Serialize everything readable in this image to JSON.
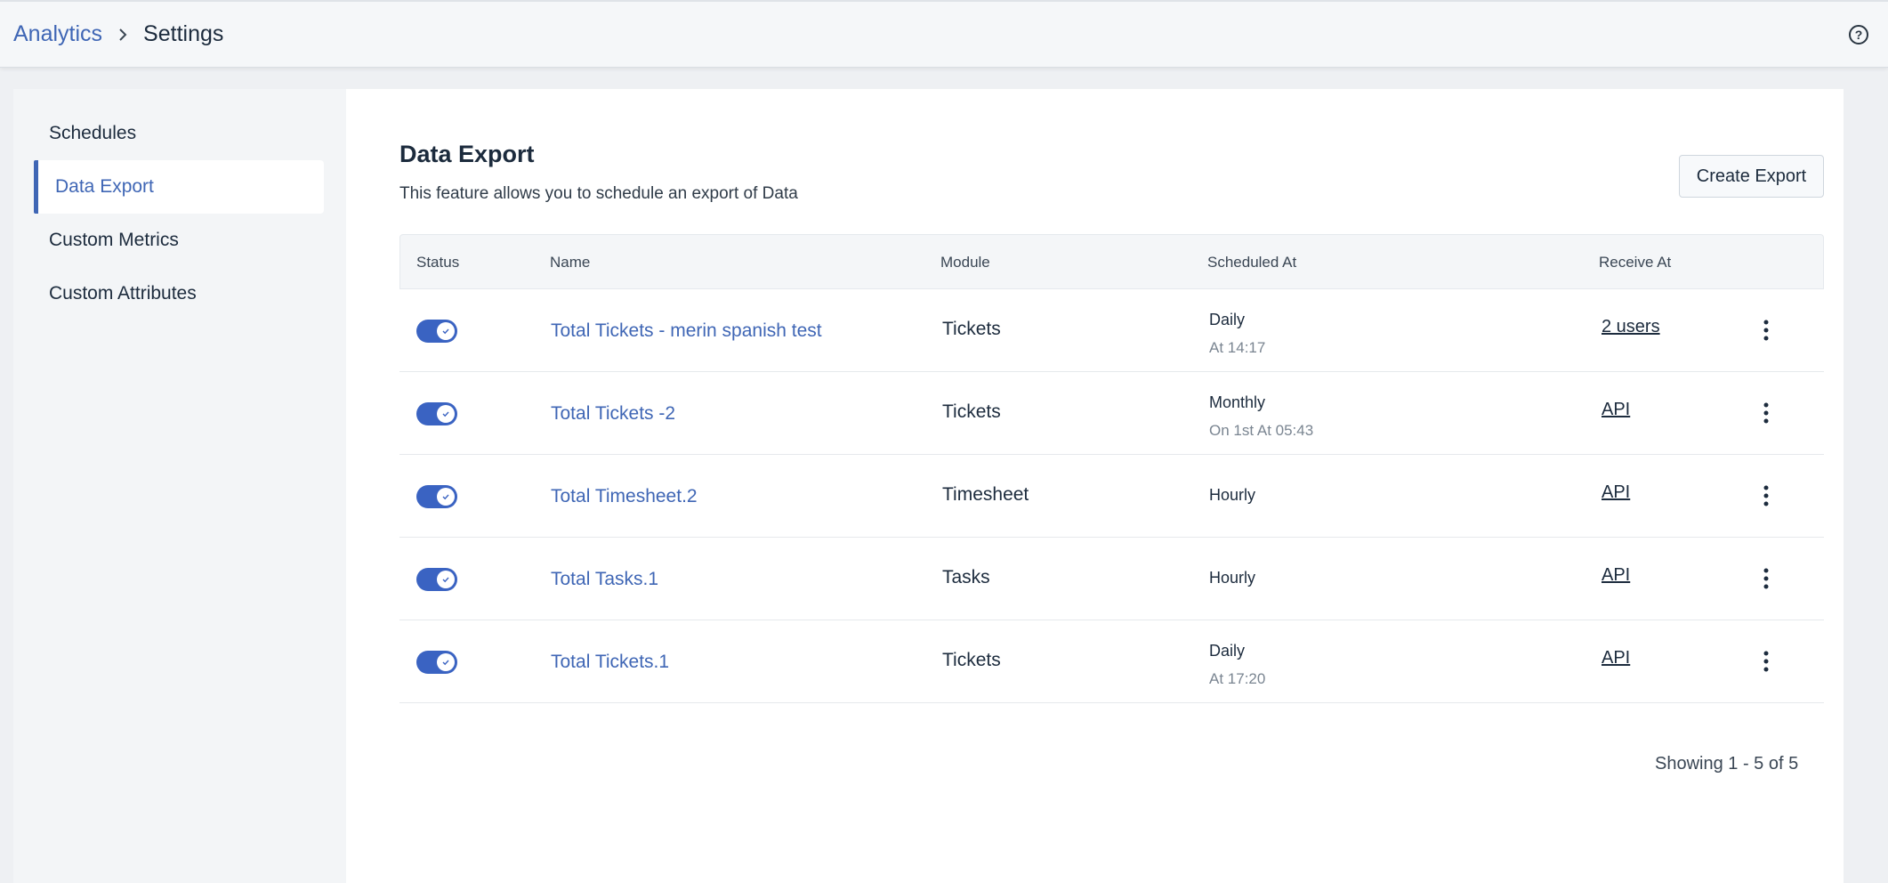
{
  "header": {
    "breadcrumb_root": "Analytics",
    "breadcrumb_current": "Settings",
    "help_icon": "help-circle-icon"
  },
  "sidebar": {
    "items": [
      {
        "label": "Schedules",
        "active": false
      },
      {
        "label": "Data Export",
        "active": true
      },
      {
        "label": "Custom Metrics",
        "active": false
      },
      {
        "label": "Custom Attributes",
        "active": false
      }
    ]
  },
  "main": {
    "title": "Data Export",
    "description": "This feature allows you to schedule an export of Data",
    "create_button": "Create Export"
  },
  "table": {
    "headers": {
      "status": "Status",
      "name": "Name",
      "module": "Module",
      "scheduled_at": "Scheduled At",
      "receive_at": "Receive At"
    },
    "rows": [
      {
        "enabled": true,
        "name": "Total Tickets - merin spanish test",
        "module": "Tickets",
        "schedule": "Daily",
        "schedule_detail": "At 14:17",
        "receive": "2 users"
      },
      {
        "enabled": true,
        "name": "Total Tickets -2",
        "module": "Tickets",
        "schedule": "Monthly",
        "schedule_detail": "On 1st At 05:43",
        "receive": "API"
      },
      {
        "enabled": true,
        "name": "Total Timesheet.2",
        "module": "Timesheet",
        "schedule": "Hourly",
        "schedule_detail": "",
        "receive": "API"
      },
      {
        "enabled": true,
        "name": "Total Tasks.1",
        "module": "Tasks",
        "schedule": "Hourly",
        "schedule_detail": "",
        "receive": "API"
      },
      {
        "enabled": true,
        "name": "Total Tickets.1",
        "module": "Tickets",
        "schedule": "Daily",
        "schedule_detail": "At 17:20",
        "receive": "API"
      }
    ]
  },
  "pagination": {
    "text": "Showing 1 - 5 of 5"
  },
  "colors": {
    "accent": "#3f66b5",
    "toggle_on": "#3a63c2"
  }
}
